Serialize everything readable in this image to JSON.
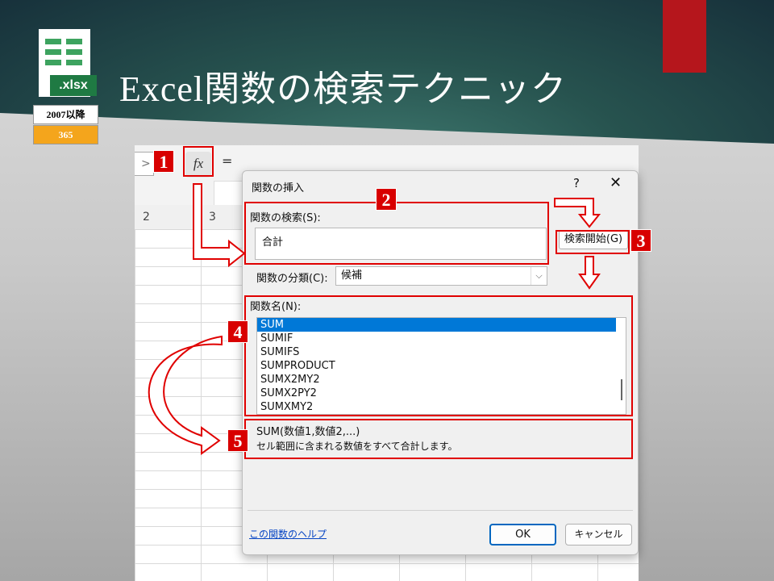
{
  "slide": {
    "title": "Excel関数の検索テクニック",
    "file_icon_label": ".xlsx",
    "version_top": "2007以降",
    "version_bottom": "365"
  },
  "excel": {
    "fx_label": "fx",
    "equals_sign": "=",
    "left_stub": ">",
    "column_headers": [
      "2",
      "3"
    ]
  },
  "dialog": {
    "title": "関数の挿入",
    "help_glyph": "?",
    "close_glyph": "✕",
    "search_label": "関数の検索(S):",
    "search_value": "合計",
    "go_button": "検索開始(G)",
    "category_label": "関数の分類(C):",
    "category_value": "候補",
    "function_list_label": "関数名(N):",
    "functions": [
      "SUM",
      "SUMIF",
      "SUMIFS",
      "SUMPRODUCT",
      "SUMX2MY2",
      "SUMX2PY2",
      "SUMXMY2"
    ],
    "selected_index": 0,
    "syntax": "SUM(数値1,数値2,...)",
    "description": "セル範囲に含まれる数値をすべて合計します。",
    "help_link": "この関数のヘルプ",
    "ok_button": "OK",
    "cancel_button": "キャンセル"
  },
  "callouts": [
    "1",
    "2",
    "3",
    "4",
    "5"
  ],
  "colors": {
    "accent_red": "#e00000",
    "title_bar_dark": "#17313b",
    "selection_blue": "#0078d7"
  }
}
